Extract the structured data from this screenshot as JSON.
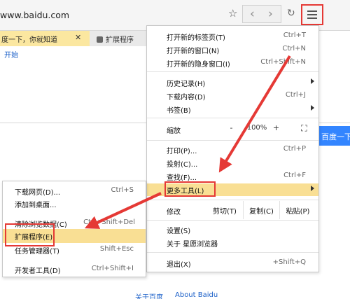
{
  "browser": {
    "url": "www.baidu.com",
    "tabs": [
      {
        "label": "度一下，你就知道",
        "close": "✕"
      },
      {
        "label": "扩展程序"
      }
    ],
    "bookmark_label": "开始"
  },
  "page": {
    "search_button_label": "百度一下",
    "footer_links": [
      "关于百度",
      "About Baidu"
    ]
  },
  "main_menu": {
    "new_tab": {
      "label": "打开新的标签页(T)",
      "shortcut": "Ctrl+T"
    },
    "new_window": {
      "label": "打开新的窗口(N)",
      "shortcut": "Ctrl+N"
    },
    "new_incognito": {
      "label": "打开新的隐身窗口(I)",
      "shortcut": "Ctrl+Shift+N"
    },
    "history": {
      "label": "历史记录(H)"
    },
    "downloads": {
      "label": "下载内容(D)",
      "shortcut": "Ctrl+J"
    },
    "bookmarks": {
      "label": "书签(B)"
    },
    "zoom": {
      "label": "缩放",
      "minus": "-",
      "value": "100%",
      "plus": "+"
    },
    "print": {
      "label": "打印(P)...",
      "shortcut": "Ctrl+P"
    },
    "cast": {
      "label": "投射(C)..."
    },
    "find": {
      "label": "查找(F)...",
      "shortcut": "Ctrl+F"
    },
    "more_tools": {
      "label": "更多工具(L)"
    },
    "edit": {
      "label": "修改",
      "cut": "剪切(T)",
      "copy": "复制(C)",
      "paste": "粘贴(P)"
    },
    "settings": {
      "label": "设置(S)"
    },
    "about": {
      "label": "关于 星愿浏览器"
    },
    "exit": {
      "label": "退出(X)",
      "shortcut": "+Shift+Q"
    }
  },
  "submenu": {
    "save_page": {
      "label": "下载网页(D)...",
      "shortcut": "Ctrl+S"
    },
    "add_desktop": {
      "label": "添加到桌面..."
    },
    "clear_data": {
      "label": "清除浏览数据(C)",
      "shortcut": "Ctrl+Shift+Del"
    },
    "extensions": {
      "label": "扩展程序(E)"
    },
    "task_manager": {
      "label": "任务管理器(T)",
      "shortcut": "Shift+Esc"
    },
    "devtools": {
      "label": "开发者工具(D)",
      "shortcut": "Ctrl+Shift+I"
    }
  },
  "colors": {
    "highlight": "#f9df94",
    "annotation": "#e53935",
    "link": "#1a5fc8"
  }
}
